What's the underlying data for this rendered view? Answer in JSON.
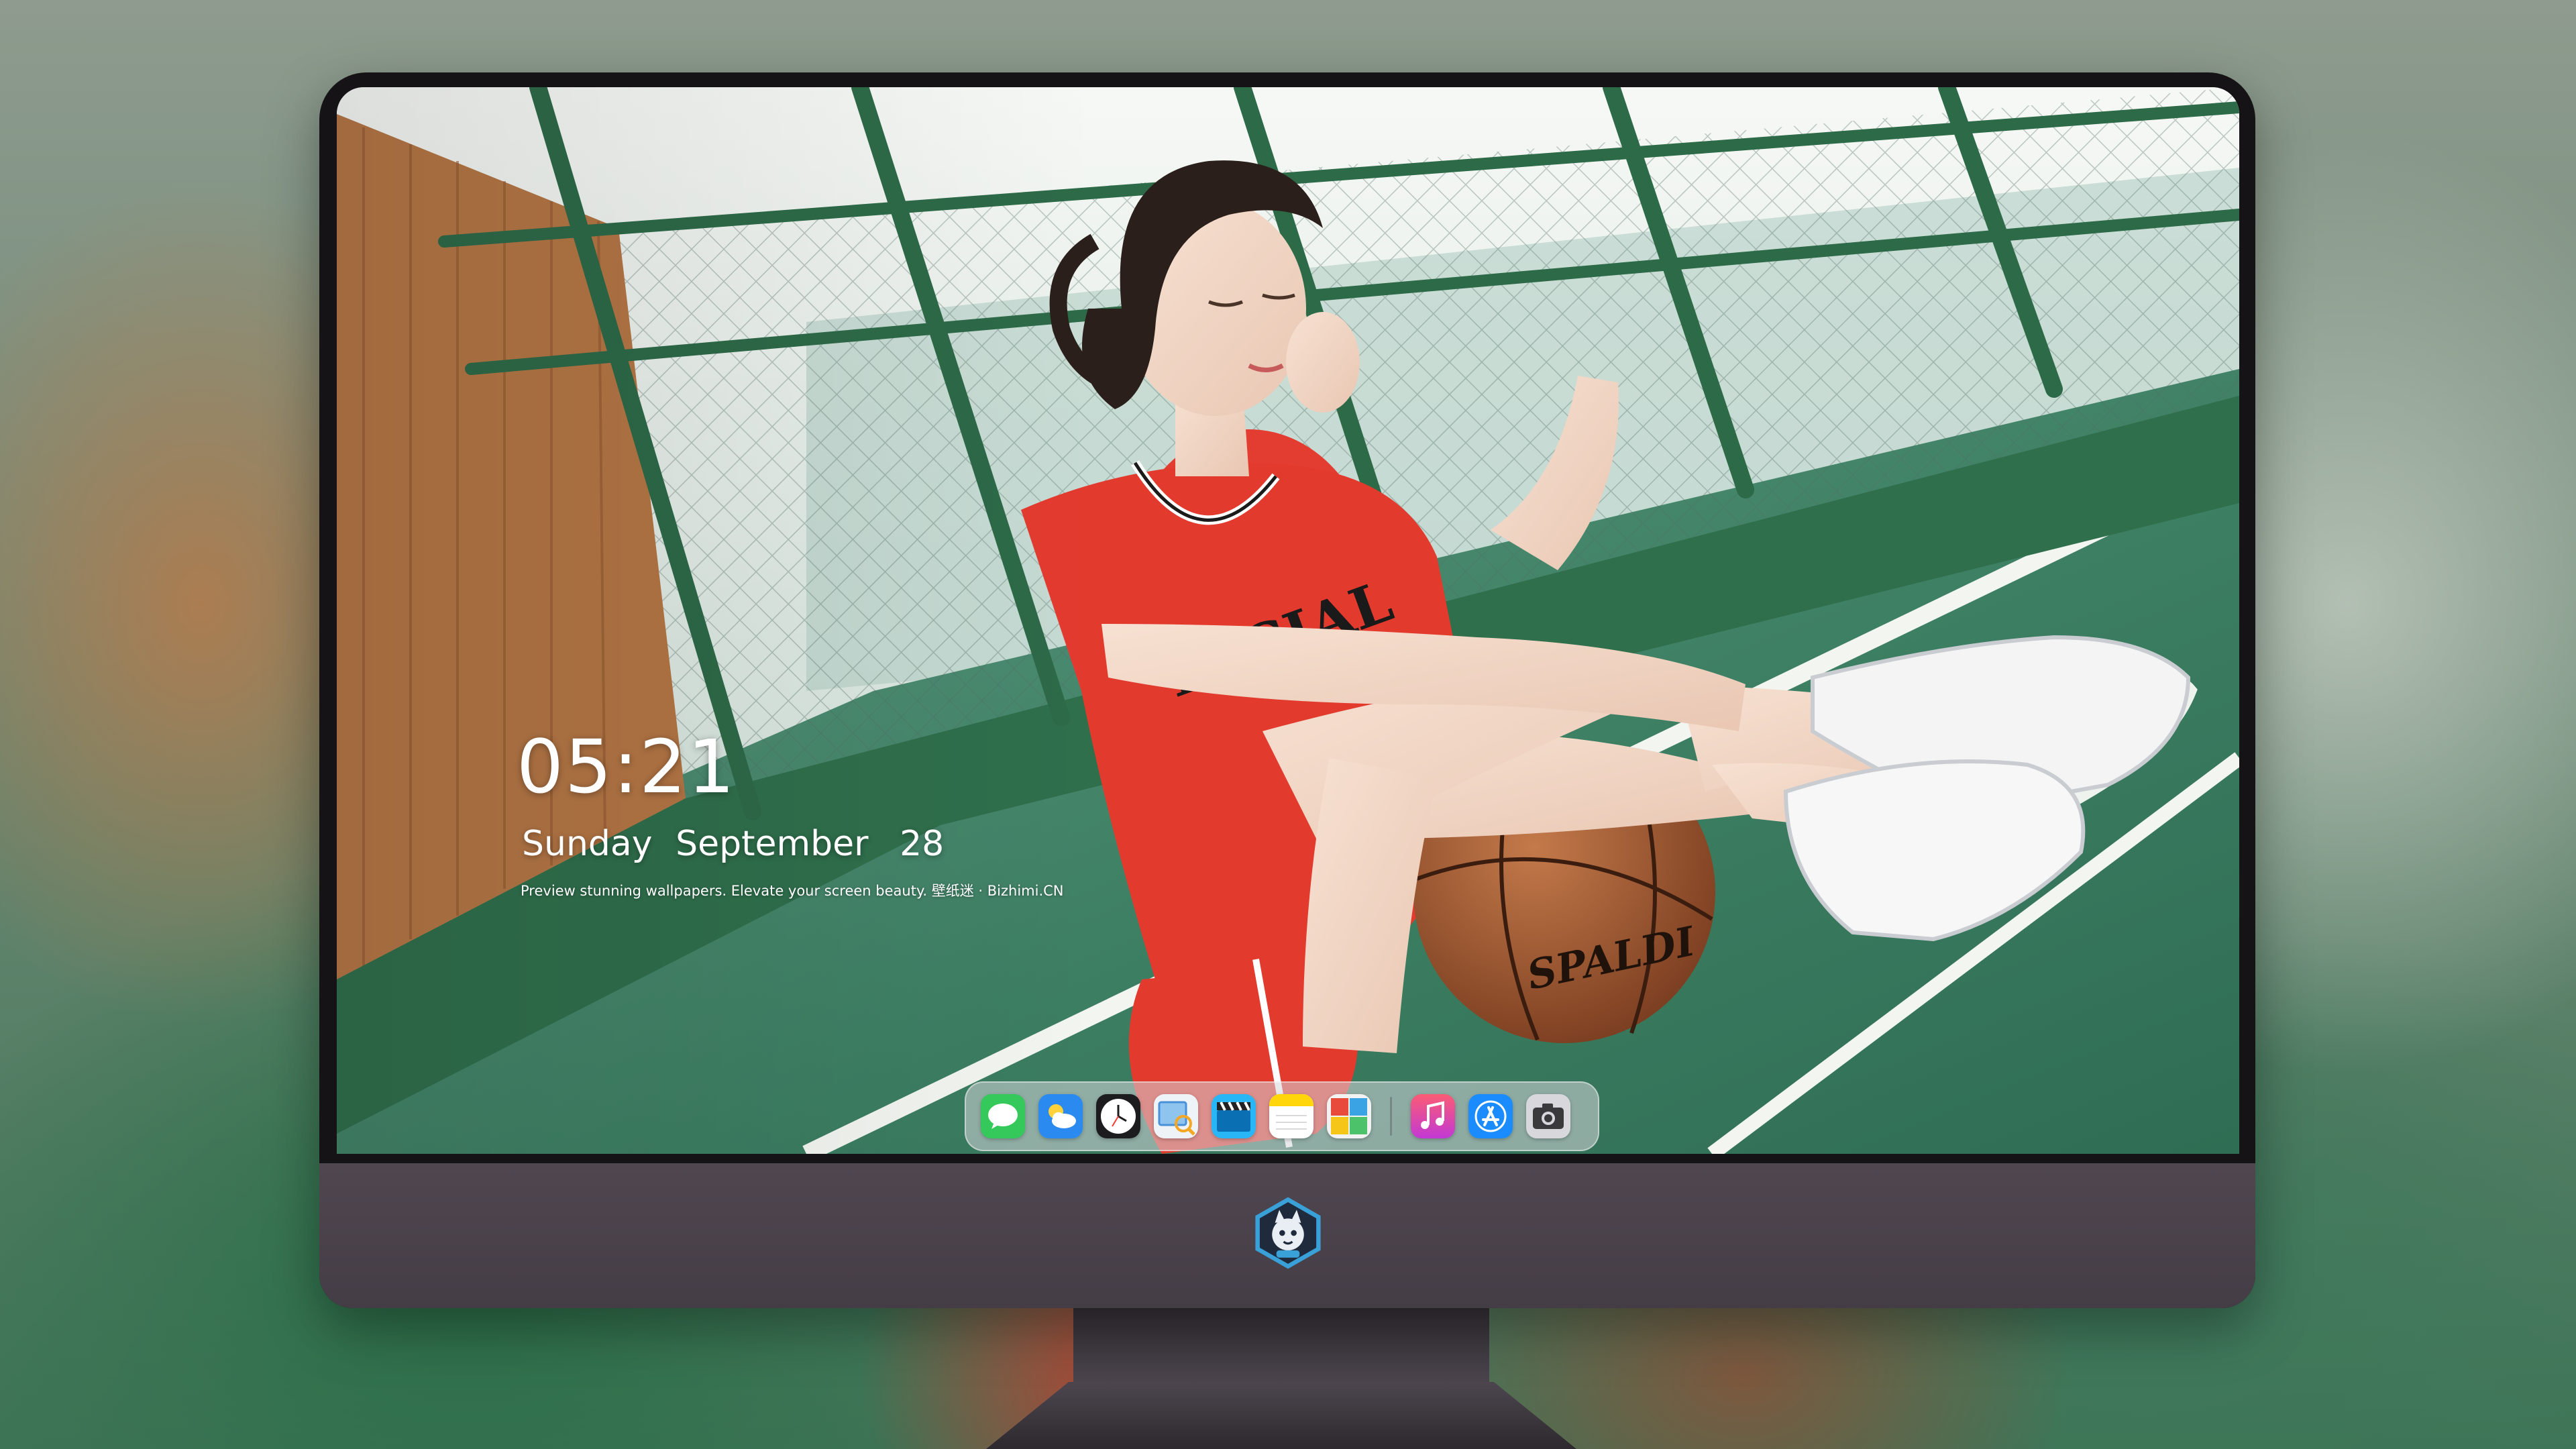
{
  "lockscreen": {
    "time": "05:21",
    "weekday": "Sunday",
    "month": "September",
    "day": "28",
    "tagline": "Preview stunning wallpapers. Elevate your screen beauty. 壁纸迷 · Bizhimi.CN"
  },
  "dock": {
    "apps": [
      {
        "name": "Messages",
        "icon": "messages-icon",
        "color": "#34c759"
      },
      {
        "name": "Weather",
        "icon": "weather-icon",
        "color": "#1e88f0"
      },
      {
        "name": "Clock",
        "icon": "clock-icon",
        "color": "#1c1c1e"
      },
      {
        "name": "Preview",
        "icon": "preview-icon",
        "color": "#4a90d9"
      },
      {
        "name": "Clips",
        "icon": "clapperboard-icon",
        "color": "#29b6f6"
      },
      {
        "name": "Notes",
        "icon": "notes-icon",
        "color": "#ffd60a"
      },
      {
        "name": "Photo Booth",
        "icon": "photo-booth-icon",
        "color": "#e84b3c"
      },
      {
        "name": "Music",
        "icon": "music-icon",
        "color": "#fc3c8d"
      },
      {
        "name": "App Store",
        "icon": "app-store-icon",
        "color": "#1a8cff"
      },
      {
        "name": "Camera",
        "icon": "camera-icon",
        "color": "#8e8e93"
      }
    ]
  },
  "colors": {
    "monitor_bezel": "#151315",
    "monitor_chin": "#4a424b",
    "court_green": "#3d7d63",
    "jersey_red": "#e23a2e"
  }
}
